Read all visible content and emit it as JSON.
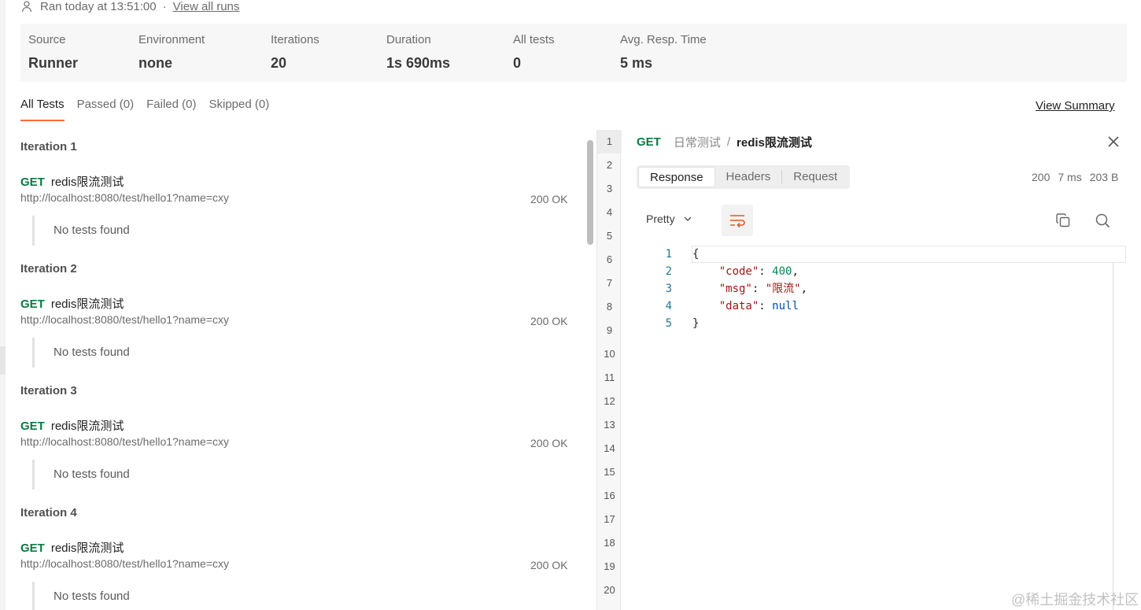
{
  "run": {
    "ran_text": "Ran today at 13:51:00",
    "separator": "·",
    "view_all_runs": "View all runs"
  },
  "stats": {
    "source": {
      "label": "Source",
      "value": "Runner"
    },
    "environment": {
      "label": "Environment",
      "value": "none"
    },
    "iterations": {
      "label": "Iterations",
      "value": "20"
    },
    "duration": {
      "label": "Duration",
      "value": "1s 690ms"
    },
    "all_tests": {
      "label": "All tests",
      "value": "0"
    },
    "avg_resp": {
      "label": "Avg. Resp. Time",
      "value": "5 ms"
    }
  },
  "tabs": [
    {
      "label": "All Tests",
      "active": true
    },
    {
      "label": "Passed (0)",
      "active": false
    },
    {
      "label": "Failed (0)",
      "active": false
    },
    {
      "label": "Skipped (0)",
      "active": false
    }
  ],
  "view_summary": "View Summary",
  "iterations": [
    {
      "title": "Iteration 1",
      "method": "GET",
      "name": "redis限流测试",
      "url": "http://localhost:8080/test/hello1?name=cxy",
      "status": "200 OK",
      "tests": "No tests found"
    },
    {
      "title": "Iteration 2",
      "method": "GET",
      "name": "redis限流测试",
      "url": "http://localhost:8080/test/hello1?name=cxy",
      "status": "200 OK",
      "tests": "No tests found"
    },
    {
      "title": "Iteration 3",
      "method": "GET",
      "name": "redis限流测试",
      "url": "http://localhost:8080/test/hello1?name=cxy",
      "status": "200 OK",
      "tests": "No tests found"
    },
    {
      "title": "Iteration 4",
      "method": "GET",
      "name": "redis限流测试",
      "url": "http://localhost:8080/test/hello1?name=cxy",
      "status": "200 OK",
      "tests": "No tests found"
    }
  ],
  "iteration_numbers": [
    "1",
    "2",
    "3",
    "4",
    "5",
    "6",
    "7",
    "8",
    "9",
    "10",
    "11",
    "12",
    "13",
    "14",
    "15",
    "16",
    "17",
    "18",
    "19",
    "20"
  ],
  "active_iteration": "1",
  "detail": {
    "method": "GET",
    "folder": "日常测试",
    "slash": "/",
    "request_name": "redis限流测试",
    "tabs": [
      "Response",
      "Headers",
      "Request"
    ],
    "active_tab": "Response",
    "status_code": "200",
    "time": "7 ms",
    "size": "203 B",
    "format": "Pretty"
  },
  "response_body": [
    {
      "n": "1",
      "text": "{"
    },
    {
      "n": "2",
      "key": "\"code\"",
      "value": "400",
      "type": "num",
      "trail": ","
    },
    {
      "n": "3",
      "key": "\"msg\"",
      "value": "\"限流\"",
      "type": "str",
      "trail": ","
    },
    {
      "n": "4",
      "key": "\"data\"",
      "value": "null",
      "type": "null",
      "trail": ""
    },
    {
      "n": "5",
      "text": "}"
    }
  ],
  "watermark": "@稀土掘金技术社区",
  "colors": {
    "accent": "#ff6c37",
    "get_method": "#0c7a43"
  }
}
